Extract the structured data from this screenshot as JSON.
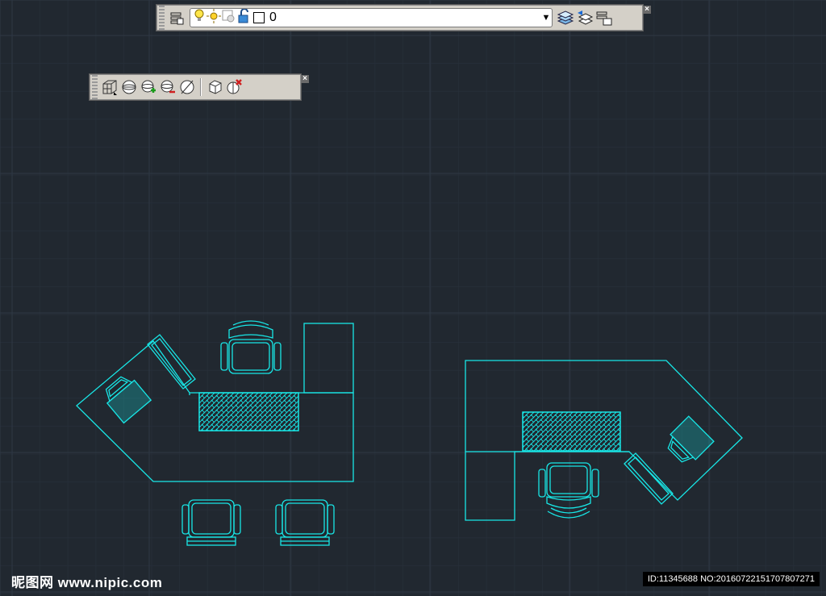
{
  "colors": {
    "background": "#212830",
    "grid": "#2e3844",
    "drawing": "#18e6e6",
    "toolbar_bg": "#d4d0c8"
  },
  "layers_toolbar": {
    "icons": [
      "layer-properties-icon",
      "bulb-on-icon",
      "sun-icon",
      "freeze-viewport-icon",
      "unlock-icon",
      "color-swatch-icon"
    ],
    "current_layer": "0",
    "right_icons": [
      "make-current-layer-icon",
      "layer-previous-icon",
      "layer-states-icon"
    ],
    "close_label": "×"
  },
  "solids_toolbar": {
    "icons": [
      "box-icon",
      "sphere-icon",
      "union-icon",
      "subtract-icon",
      "slice-icon",
      "extrude-face-icon",
      "delete-face-icon"
    ],
    "close_label": "×"
  },
  "drawing": {
    "left_desk": {
      "chairs": 3,
      "monitor": true,
      "keyboard_hatch": true
    },
    "right_desk": {
      "chairs": 1,
      "monitor": true,
      "keyboard_hatch": true
    }
  },
  "watermark": {
    "left": "昵图网 www.nipic.com",
    "right": "ID:11345688 NO:20160722151707807271"
  }
}
